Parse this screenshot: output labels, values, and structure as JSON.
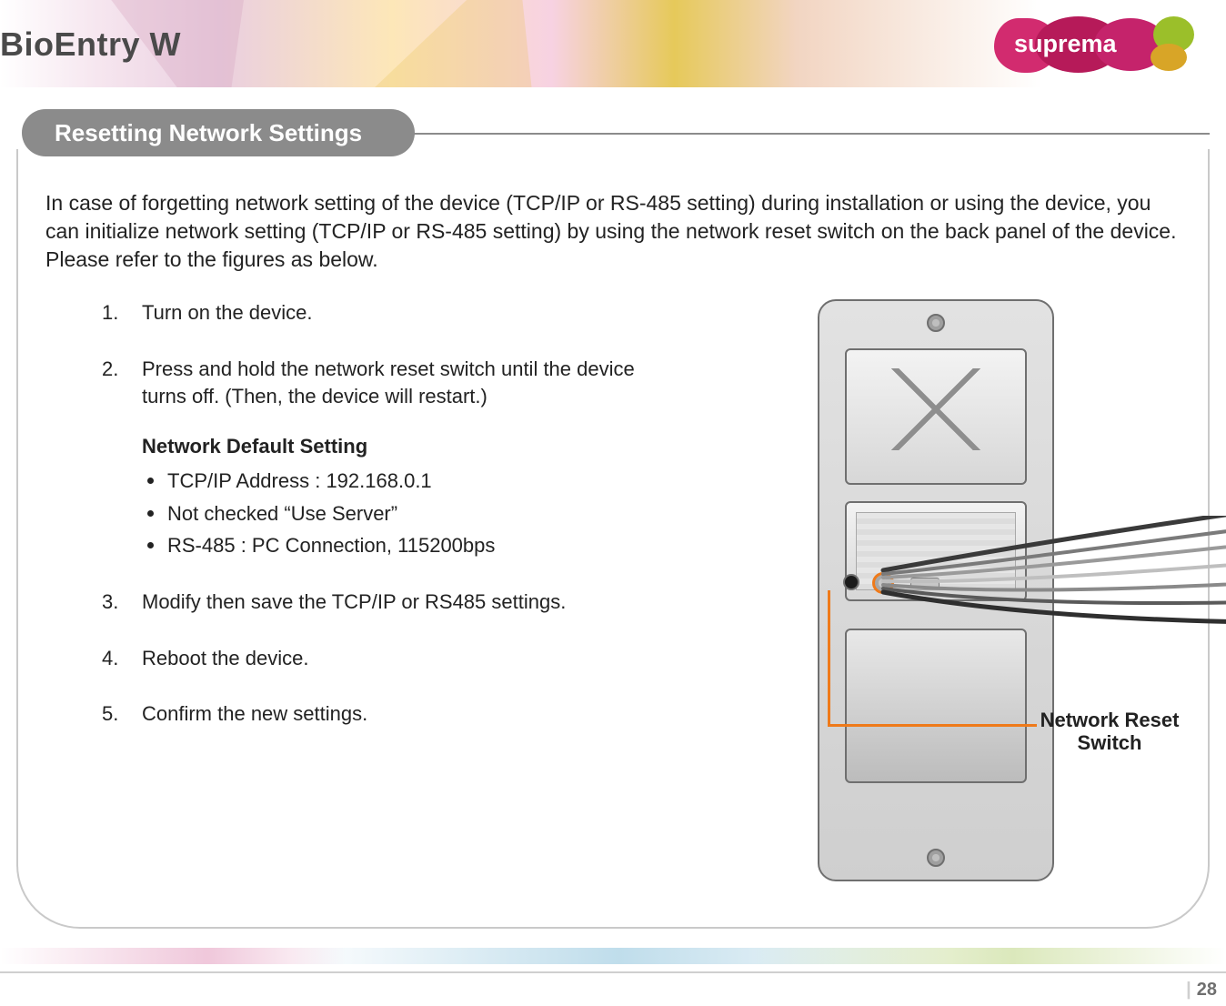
{
  "header": {
    "product_title": "BioEntry  W",
    "brand": "suprema"
  },
  "section": {
    "title": "Resetting Network Settings"
  },
  "intro": "In case of forgetting network setting of the device (TCP/IP or RS-485 setting) during installation or using the device, you can initialize network setting (TCP/IP or RS-485 setting) by using the network reset switch on the back panel of the device. Please refer to the figures as below.",
  "steps": {
    "s1": "Turn on the device.",
    "s2": "Press and hold the network reset switch until the device turns off. (Then, the device will restart.)",
    "default_heading": "Network Default Setting",
    "defaults": {
      "d1": "TCP/IP Address : 192.168.0.1",
      "d2": "Not checked “Use Server”",
      "d3": "RS-485 : PC Connection, 115200bps"
    },
    "s3": "Modify then save the TCP/IP or RS485 settings.",
    "s4": "Reboot the device.",
    "s5": "Confirm the new settings."
  },
  "figure": {
    "callout": "Network Reset Switch"
  },
  "footer": {
    "page": "28"
  }
}
